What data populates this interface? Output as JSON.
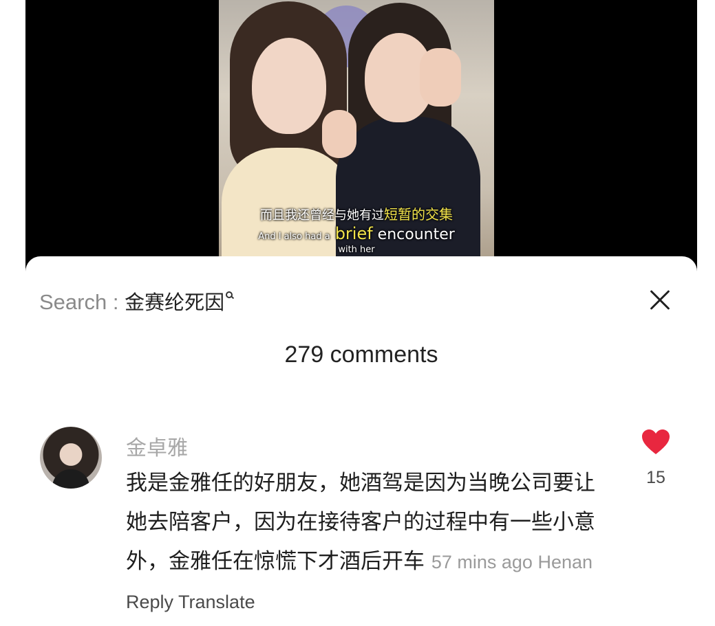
{
  "video": {
    "subtitle_cn_prefix": "而且我还曾经与她有过",
    "subtitle_cn_highlight": "短暂的交集",
    "subtitle_en_small": "And I also had a",
    "subtitle_en_highlight": "brief",
    "subtitle_en_rest": " encounter",
    "subtitle_en_line2": "with her"
  },
  "header": {
    "search_label": "Search : ",
    "search_query": "金赛纶死因",
    "search_icon": "search-icon",
    "close_icon": "close-icon"
  },
  "comments_header": {
    "count_text": "279 comments"
  },
  "comment": {
    "username": "金卓雅",
    "text": "我是金雅任的好朋友，她酒驾是因为当晚公司要让她去陪客户，因为在接待客户的过程中有一些小意外，金雅任在惊慌下才酒后开车",
    "time": "57 mins ago",
    "location": "Henan",
    "reply_label": "Reply",
    "translate_label": "Translate",
    "like_count": "15",
    "like_icon": "heart-icon",
    "like_color": "#e8273f"
  }
}
